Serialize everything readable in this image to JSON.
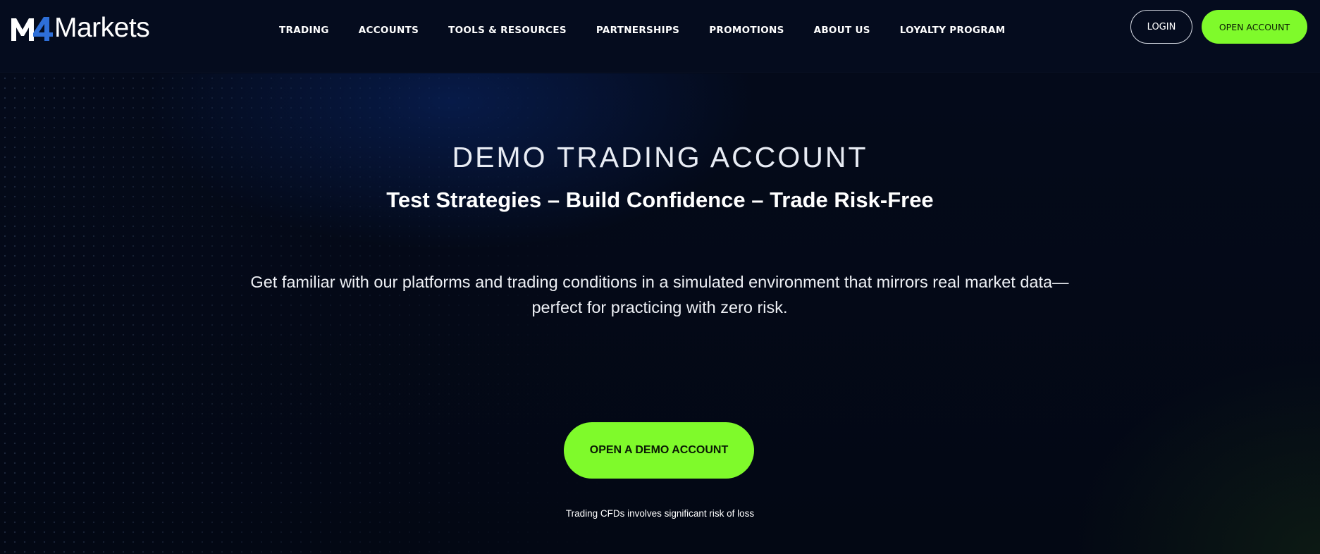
{
  "brand": {
    "logo_mark": "M4",
    "logo_text": "Markets",
    "accent": "#7ffa2b",
    "logo_blue": "#2e6fd8",
    "background": "#030814"
  },
  "header": {
    "nav": [
      {
        "label": "TRADING"
      },
      {
        "label": "ACCOUNTS"
      },
      {
        "label": "TOOLS & RESOURCES"
      },
      {
        "label": "PARTNERSHIPS"
      },
      {
        "label": "PROMOTIONS"
      },
      {
        "label": "ABOUT US"
      },
      {
        "label": "LOYALTY PROGRAM"
      }
    ],
    "login_label": "LOGIN",
    "open_account_label": "OPEN ACCOUNT"
  },
  "hero": {
    "title": "DEMO TRADING ACCOUNT",
    "subtitle": "Test Strategies – Build Confidence – Trade Risk-Free",
    "description": "Get familiar with our platforms and trading conditions in a simulated environment that mirrors real market data—perfect for practicing with zero risk.",
    "cta_label": "OPEN A DEMO ACCOUNT",
    "risk_warning": "Trading CFDs involves significant risk of loss"
  }
}
